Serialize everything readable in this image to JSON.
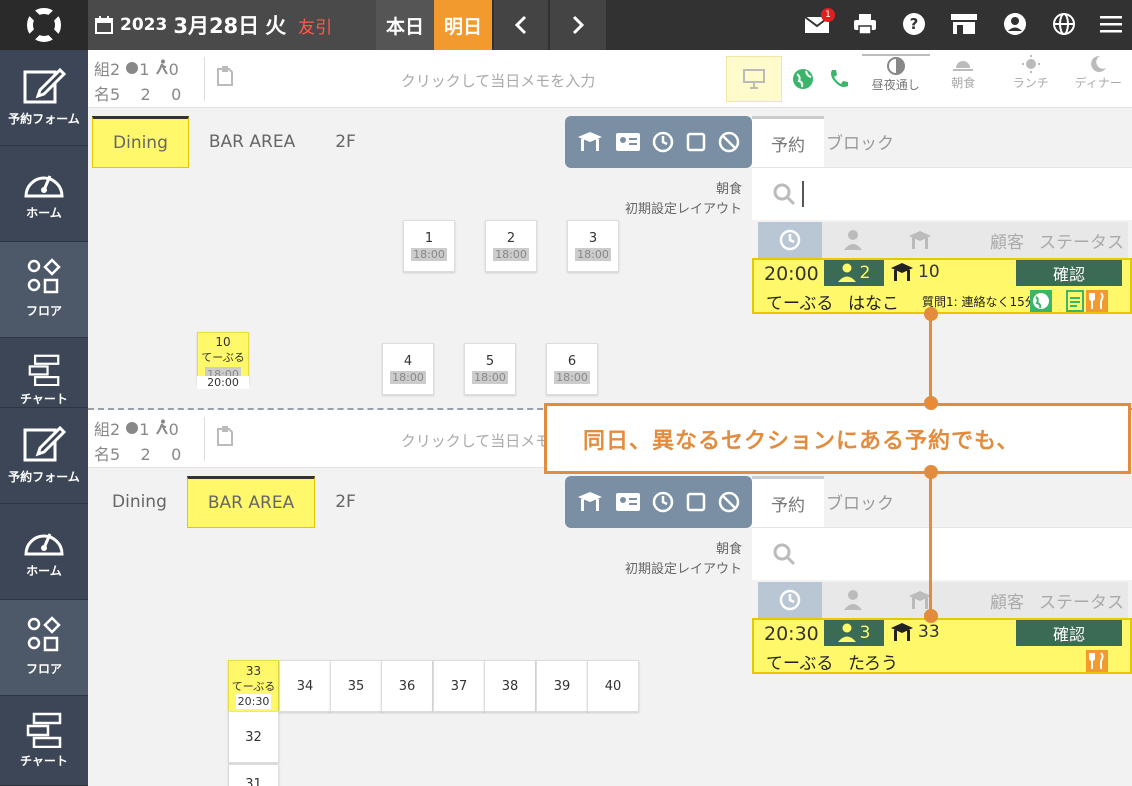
{
  "header": {
    "year": "2023",
    "date": "3月28日",
    "weekday": "火",
    "rokuyo": "友引",
    "today_label": "本日",
    "tomorrow_label": "明日",
    "mail_badge": "1"
  },
  "sidebar": [
    {
      "label": "予約フォーム"
    },
    {
      "label": "ホーム"
    },
    {
      "label": "フロア"
    },
    {
      "label": "チャート"
    }
  ],
  "stats": {
    "groups_label": "組",
    "groups_value": "2",
    "web_value": "1",
    "walkin_value": "0",
    "persons_label": "名",
    "persons_value": "5",
    "persons_web": "2",
    "persons_walkin": "0"
  },
  "memo_placeholder": "クリックして当日メモを入力",
  "meal_periods": [
    {
      "label": "昼夜通し"
    },
    {
      "label": "朝食"
    },
    {
      "label": "ランチ"
    },
    {
      "label": "ディナー"
    }
  ],
  "layout_meta": {
    "period": "朝食",
    "layout": "初期設定レイアウト"
  },
  "reservation_tabs": {
    "reserve": "予約",
    "block": "ブロック"
  },
  "reservation_headers": {
    "customer": "顧客",
    "status": "ステータス"
  },
  "panel1": {
    "area_tabs": [
      "Dining",
      "BAR AREA",
      "2F"
    ],
    "selected_tab": "Dining",
    "tables": [
      {
        "num": "1",
        "time": "18:00"
      },
      {
        "num": "2",
        "time": "18:00"
      },
      {
        "num": "3",
        "time": "18:00"
      },
      {
        "num": "4",
        "time": "18:00"
      },
      {
        "num": "5",
        "time": "18:00"
      },
      {
        "num": "6",
        "time": "18:00"
      }
    ],
    "highlight_table": {
      "num": "10",
      "name": "てーぶる",
      "time": "18:00",
      "end": "20:00"
    },
    "reservation": {
      "time": "20:00",
      "persons": "2",
      "table": "10",
      "status": "確認",
      "table_name": "てーぶる",
      "customer": "はなこ",
      "note": "質問1: 連絡なく15分"
    }
  },
  "panel2": {
    "area_tabs": [
      "Dining",
      "BAR AREA",
      "2F"
    ],
    "selected_tab": "BAR AREA",
    "tables_row": [
      "34",
      "35",
      "36",
      "37",
      "38",
      "39",
      "40"
    ],
    "highlight_table": {
      "num": "33",
      "name": "てーぶる",
      "time": "20:30"
    },
    "table_32": "32",
    "table_31": "31",
    "reservation": {
      "time": "20:30",
      "persons": "3",
      "table": "33",
      "status": "確認",
      "table_name": "てーぶる",
      "customer": "たろう"
    }
  },
  "callout": {
    "text": "同日、異なるセクションにある予約でも、"
  },
  "colors": {
    "accent_orange": "#f29a2e",
    "highlight_yellow": "#fff86b",
    "status_green": "#3b6b55",
    "callout_orange": "#e38c3d"
  }
}
